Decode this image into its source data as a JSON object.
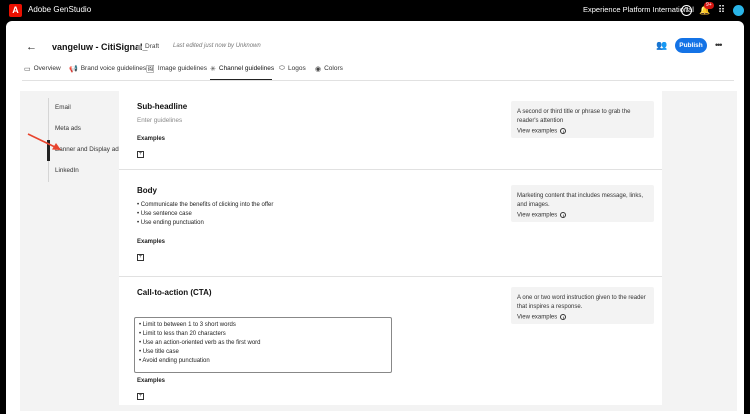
{
  "topbar": {
    "logo_glyph": "A",
    "app_name": "Adobe GenStudio",
    "org_name": "Experience Platform International",
    "help_glyph": "?",
    "bell_glyph": "🔔",
    "badge": "9+",
    "apps_glyph": "⠿"
  },
  "header": {
    "back_glyph": "←",
    "title": "vangeluw - CitiSignal_",
    "status": "Draft",
    "last_edited": "Last edited just now by Unknown",
    "share_glyph": "👥",
    "publish_label": "Publish",
    "more_glyph": "•••"
  },
  "tabs": [
    {
      "label": "Overview",
      "icon": "overview-icon",
      "glyph": "▭"
    },
    {
      "label": "Brand voice guidelines",
      "icon": "megaphone-icon",
      "glyph": "📢"
    },
    {
      "label": "Image guidelines",
      "icon": "image-icon",
      "glyph": "🖼"
    },
    {
      "label": "Channel guidelines",
      "icon": "channel-icon",
      "glyph": "✳"
    },
    {
      "label": "Logos",
      "icon": "logo-icon",
      "glyph": "⬭"
    },
    {
      "label": "Colors",
      "icon": "palette-icon",
      "glyph": "◉"
    }
  ],
  "active_tab": "Channel guidelines",
  "sidenav": {
    "items": [
      "Email",
      "Meta ads",
      "Banner and Display ads",
      "LinkedIn"
    ],
    "active": "Banner and Display ads"
  },
  "sections": {
    "subheadline": {
      "title": "Sub-headline",
      "placeholder": "Enter guidelines",
      "examples_label": "Examples",
      "help": "A second or third title or phrase to grab the reader's attention",
      "view_examples": "View examples"
    },
    "body": {
      "title": "Body",
      "bullets": [
        "• Communicate the benefits of clicking into the offer",
        "• Use sentence case",
        "• Use ending punctuation"
      ],
      "examples_label": "Examples",
      "help": "Marketing content that includes message, links, and images.",
      "view_examples": "View examples"
    },
    "cta": {
      "title": "Call-to-action (CTA)",
      "bullets": [
        "• Limit to between 1 to 3 short words",
        "• Limit to less than 20 characters",
        "• Use an action-oriented verb as the first word",
        "• Use title case",
        "• Avoid ending punctuation"
      ],
      "examples_label": "Examples",
      "help": "A one or two word instruction given to the reader that inspires a response.",
      "view_examples": "View examples"
    }
  },
  "add_glyph": "+",
  "info_glyph": "i",
  "colors": {
    "accent": "#1473e6",
    "logo": "#eb1000",
    "arrow": "#e8442e",
    "badge": "#d31510"
  }
}
